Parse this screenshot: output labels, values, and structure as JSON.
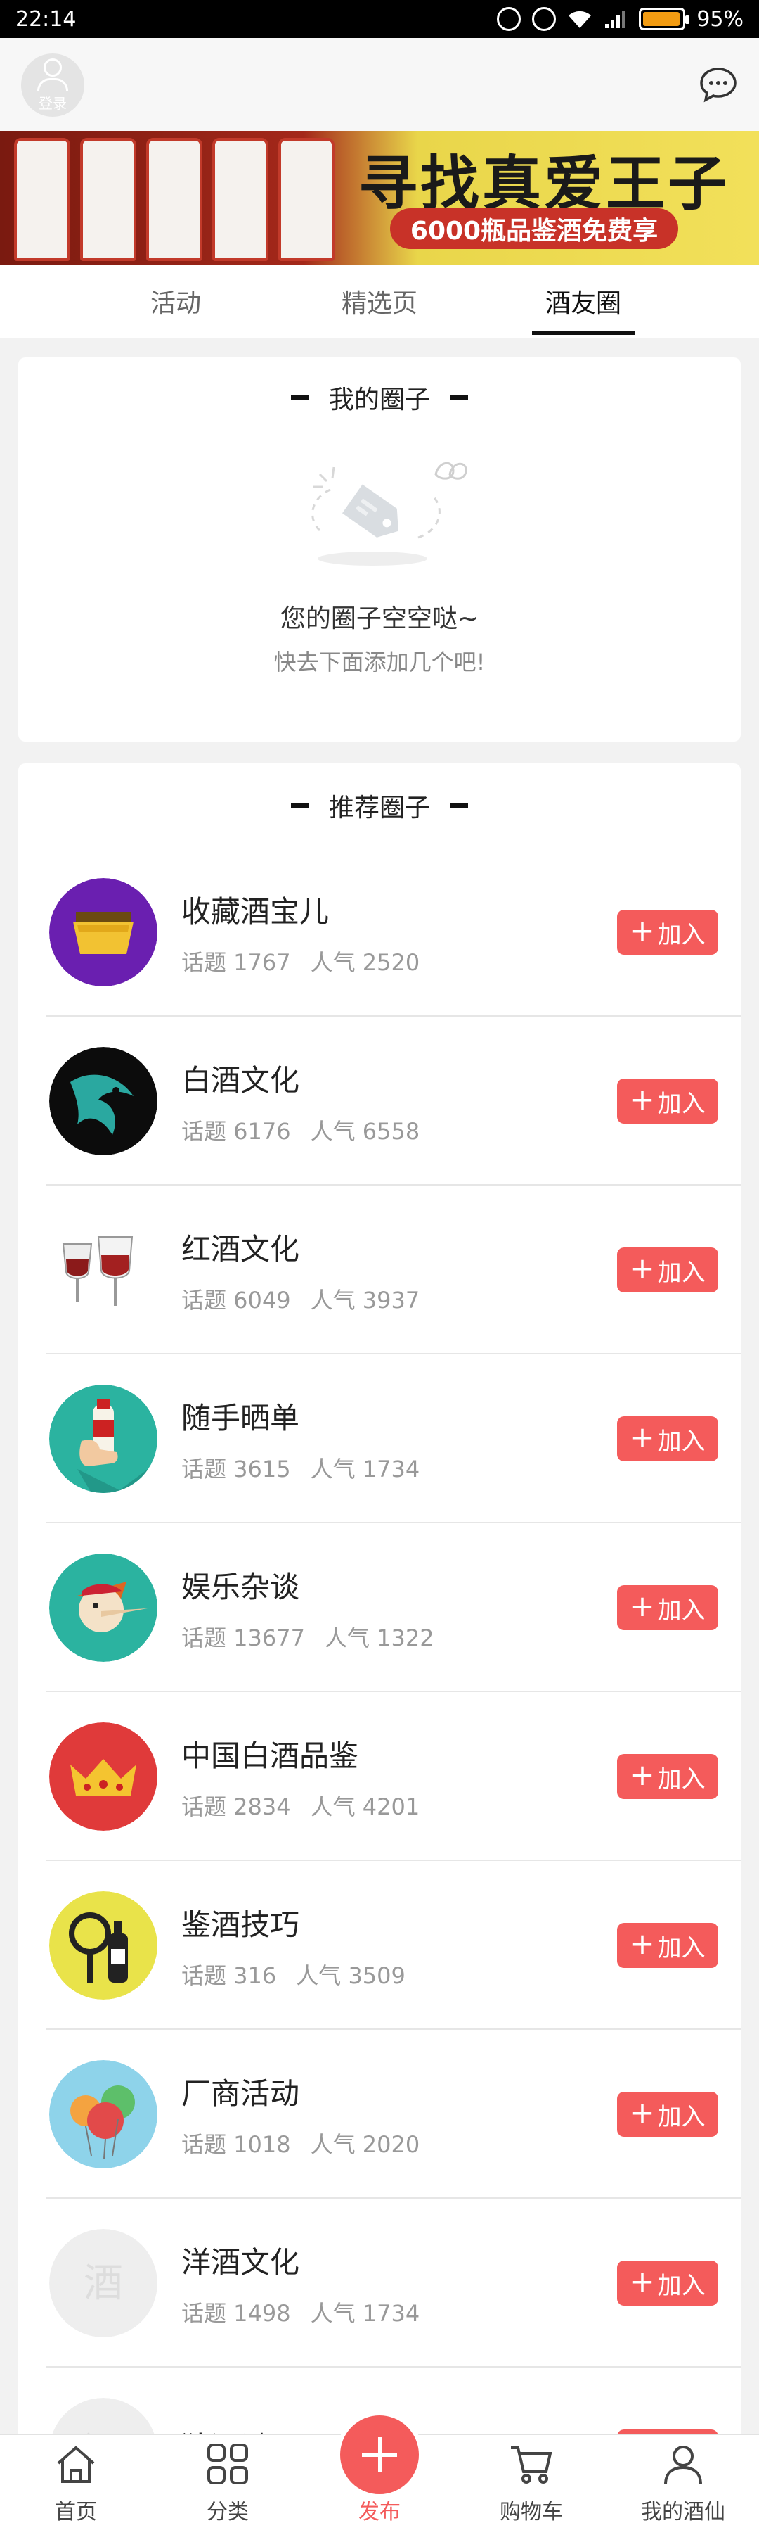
{
  "status_bar": {
    "time": "22:14",
    "battery": "95%",
    "battery_level": 0.95
  },
  "header": {
    "login_label": "登录"
  },
  "banner": {
    "slogan": "寻找真爱王子",
    "promo": "6000瓶品鉴酒免费享"
  },
  "tabs": [
    {
      "label": "活动",
      "active": false
    },
    {
      "label": "精选页",
      "active": false
    },
    {
      "label": "酒友圈",
      "active": true
    }
  ],
  "my_circles": {
    "title": "我的圈子",
    "empty_line1": "您的圈子空空哒~",
    "empty_line2": "快去下面添加几个吧!"
  },
  "recommended": {
    "title": "推荐圈子",
    "join_label": "加入",
    "items": [
      {
        "name": "收藏酒宝儿",
        "topics": "话题 1767",
        "popularity": "人气 2520",
        "icon": "treasure-box-icon",
        "color": "#6a1fb0"
      },
      {
        "name": "白酒文化",
        "topics": "话题 6176",
        "popularity": "人气 6558",
        "icon": "dragon-icon",
        "color": "#0c0c0c"
      },
      {
        "name": "红酒文化",
        "topics": "话题 6049",
        "popularity": "人气 3937",
        "icon": "wine-glasses-icon",
        "color": "#ffffff"
      },
      {
        "name": "随手晒单",
        "topics": "话题 3615",
        "popularity": "人气 1734",
        "icon": "hand-bottle-icon",
        "color": "#2bb3a0"
      },
      {
        "name": "娱乐杂谈",
        "topics": "话题 13677",
        "popularity": "人气 1322",
        "icon": "pinocchio-icon",
        "color": "#2bb3a0"
      },
      {
        "name": "中国白酒品鉴",
        "topics": "话题 2834",
        "popularity": "人气 4201",
        "icon": "crown-icon",
        "color": "#e03a3a"
      },
      {
        "name": "鉴酒技巧",
        "topics": "话题 316",
        "popularity": "人气 3509",
        "icon": "magnifier-bottle-icon",
        "color": "#e9e34a"
      },
      {
        "name": "厂商活动",
        "topics": "话题 1018",
        "popularity": "人气 2020",
        "icon": "balloons-icon",
        "color": "#8ed3ea"
      },
      {
        "name": "洋酒文化",
        "topics": "话题 1498",
        "popularity": "人气 1734",
        "icon": "placeholder-jiu-icon",
        "color": "#eeeeee"
      },
      {
        "name": "猜酒谜",
        "topics": "",
        "popularity": "",
        "icon": "placeholder-jiu-icon",
        "color": "#eeeeee"
      }
    ]
  },
  "bottom_nav": [
    {
      "label": "首页",
      "icon": "home-icon"
    },
    {
      "label": "分类",
      "icon": "grid-icon"
    },
    {
      "label": "发布",
      "icon": "plus-icon"
    },
    {
      "label": "购物车",
      "icon": "cart-icon"
    },
    {
      "label": "我的酒仙",
      "icon": "user-icon"
    }
  ]
}
